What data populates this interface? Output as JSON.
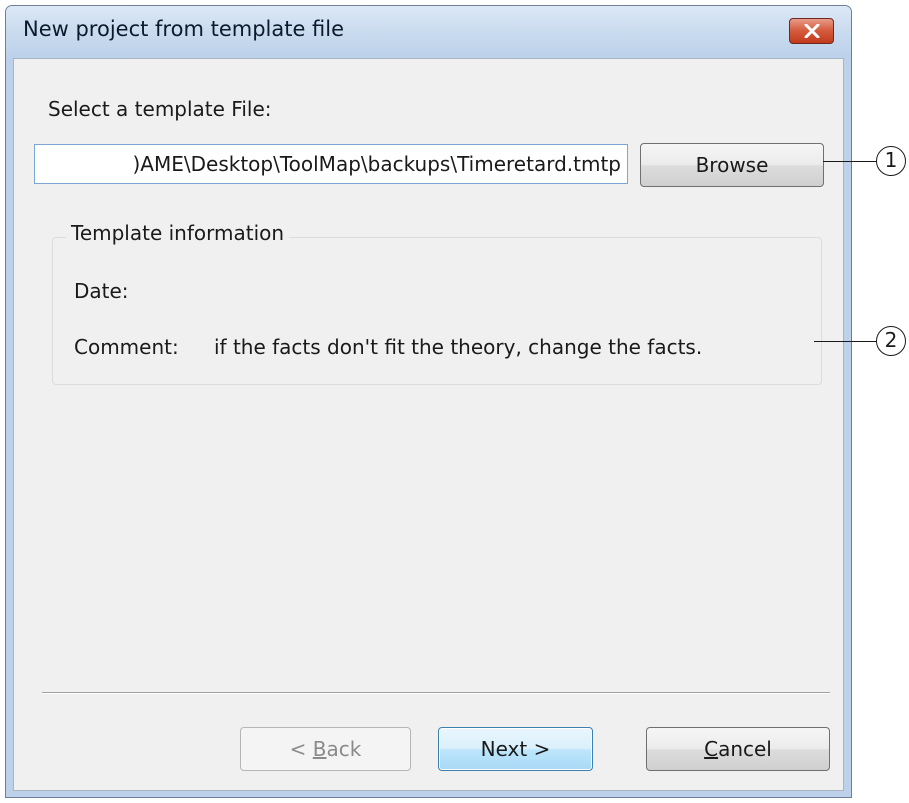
{
  "window": {
    "title": "New project from template file",
    "close_icon": "close-x-icon"
  },
  "form": {
    "select_label": "Select a template File:",
    "path_value": ")AME\\Desktop\\ToolMap\\backups\\Timeretard.tmtp",
    "browse_label": "Browse"
  },
  "template_info": {
    "group_title": "Template information",
    "date_label": "Date:",
    "date_value": "",
    "comment_label": "Comment:",
    "comment_value": "if the facts don't fit the theory, change the facts."
  },
  "footer": {
    "back_prefix": "< ",
    "back_mnemonic": "B",
    "back_rest": "ack",
    "next_label": "Next >",
    "cancel_mnemonic": "C",
    "cancel_rest": "ancel"
  },
  "callouts": {
    "one": "1",
    "two": "2"
  },
  "colors": {
    "titlebar": "#c9dbef",
    "close_button": "#d45a3c",
    "client_bg": "#f0f0f0",
    "default_button_border": "#3c7fb1"
  }
}
